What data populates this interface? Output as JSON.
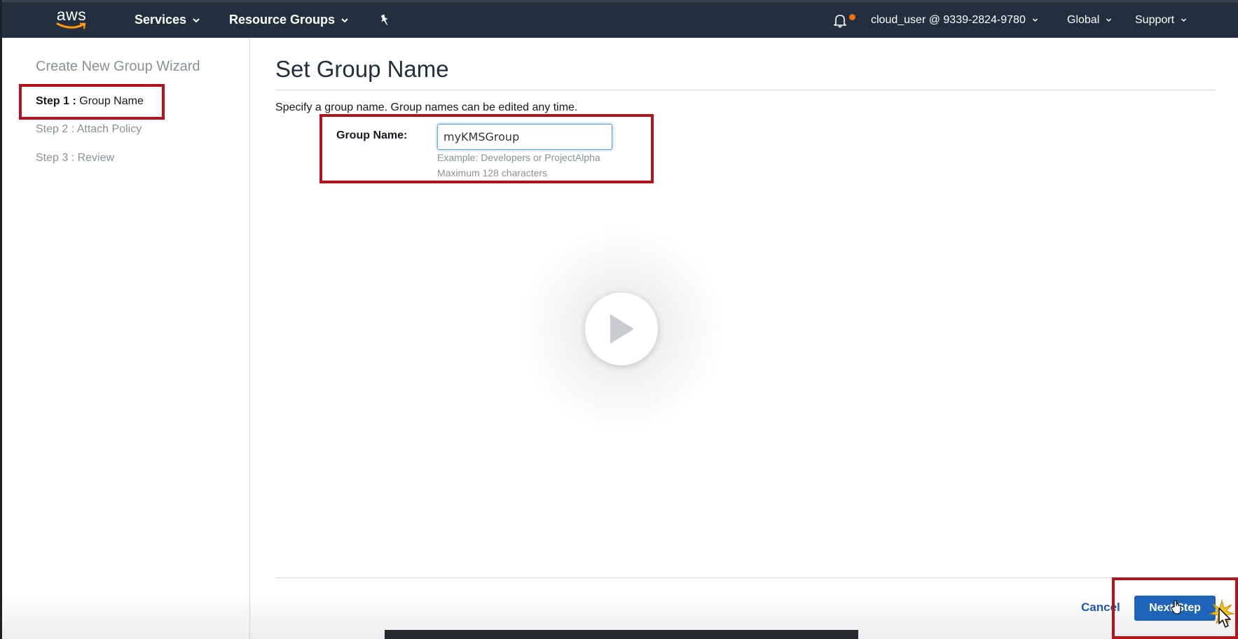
{
  "topnav": {
    "logo_text": "aws",
    "services_label": "Services",
    "resource_groups_label": "Resource Groups",
    "account_label": "cloud_user @ 9339-2824-9780",
    "region_label": "Global",
    "support_label": "Support",
    "icons": [
      "pin-icon",
      "bell-icon"
    ]
  },
  "sidebar": {
    "title": "Create New Group Wizard",
    "steps": [
      {
        "prefix": "Step 1 :",
        "label": "Group Name",
        "active": true
      },
      {
        "text": "Step 2 : Attach Policy"
      },
      {
        "text": "Step 3 : Review"
      }
    ]
  },
  "main": {
    "title": "Set Group Name",
    "description": "Specify a group name. Group names can be edited any time.",
    "group_name_label": "Group Name:",
    "group_name_value": "myKMSGroup",
    "hint_example": "Example: Developers or ProjectAlpha",
    "hint_max": "Maximum 128 characters"
  },
  "footer": {
    "cancel_label": "Cancel",
    "next_label": "Next Step"
  },
  "colors": {
    "nav_bg": "#232f3e",
    "annotation_red": "#b3131b",
    "primary_button": "#1f64b8",
    "notification_dot": "#ec7211"
  }
}
